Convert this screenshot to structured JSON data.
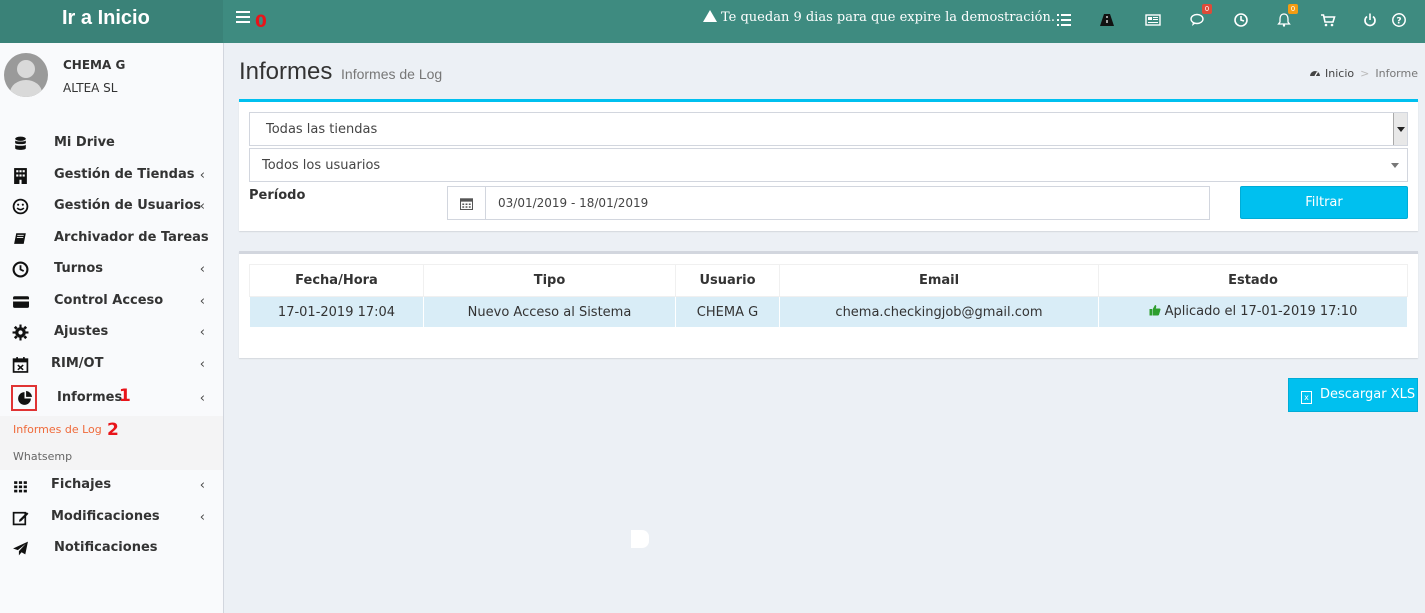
{
  "brand": {
    "title": "Ir a Inicio"
  },
  "annotations": {
    "a0": "0",
    "a1": "1",
    "a2": "2"
  },
  "topbar": {
    "trial_message": "Te quedan 9 dias para que expire la demostración.",
    "icons": [
      "tasks-icon",
      "road-icon",
      "newspaper-icon",
      "comments-icon",
      "clock-icon",
      "bell-icon",
      "cart-icon",
      "power-icon",
      "help-icon"
    ],
    "comments_badge": "0",
    "bell_badge": "0"
  },
  "user": {
    "name": "CHEMA G",
    "company": "ALTEA SL"
  },
  "sidebar": {
    "items": [
      {
        "label": "Mi Drive",
        "icon": "database-icon"
      },
      {
        "label": "Gestión de Tiendas",
        "icon": "building-icon"
      },
      {
        "label": "Gestión de Usuarios",
        "icon": "smile-icon"
      },
      {
        "label": "Archivador de Tareas",
        "icon": "book-icon"
      },
      {
        "label": "Turnos",
        "icon": "clock-icon"
      },
      {
        "label": "Control Acceso",
        "icon": "credit-card-icon"
      },
      {
        "label": "Ajustes",
        "icon": "gear-icon"
      },
      {
        "label": "RIM/OT",
        "icon": "calendar-x-icon"
      },
      {
        "label": "Informes",
        "icon": "pie-chart-icon"
      },
      {
        "label": "Fichajes",
        "icon": "grid-icon"
      },
      {
        "label": "Modificaciones",
        "icon": "edit-icon"
      },
      {
        "label": "Notificaciones",
        "icon": "paper-plane-icon"
      }
    ],
    "sub_items": [
      {
        "label": "Informes de Log"
      },
      {
        "label": "Whatsemp"
      }
    ]
  },
  "page": {
    "title": "Informes",
    "subtitle": "Informes de Log",
    "breadcrumb": {
      "home": "Inicio",
      "current": "Informe"
    }
  },
  "filters": {
    "store_select": "Todas las tiendas",
    "user_select": "Todos los usuarios",
    "period_label": "Período",
    "date_range": "03/01/2019 - 18/01/2019",
    "filter_button": "Filtrar"
  },
  "table": {
    "headers": [
      "Fecha/Hora",
      "Tipo",
      "Usuario",
      "Email",
      "Estado"
    ],
    "rows": [
      [
        "17-01-2019 17:04",
        "Nuevo Acceso al Sistema",
        "CHEMA G",
        "chema.checkingjob@gmail.com",
        "Aplicado el 17-01-2019 17:10"
      ]
    ]
  },
  "download_button": "Descargar XLS",
  "colors": {
    "topbar": "#3e8b80",
    "accent": "#00c0ef",
    "row_highlight": "#d9edf7",
    "annotation": "#e8141a"
  }
}
